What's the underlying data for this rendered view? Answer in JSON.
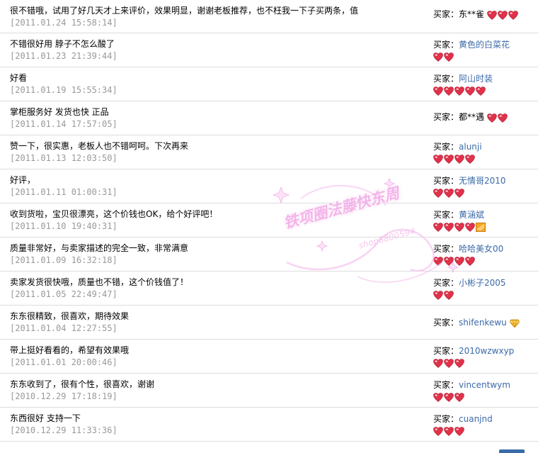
{
  "buyer_prefix": "买家：",
  "reviews": [
    {
      "comment": "很不错哦，试用了好几天才上来评价，效果明显，谢谢老板推荐，也不枉我一下子买两条，值",
      "date": "[2011.01.24 15:58:14]",
      "buyer": "东**雀",
      "hearts": 3
    },
    {
      "comment": "不错很好用 脖子不怎么酸了",
      "date": "[2011.01.23 21:39:44]",
      "buyer": "黄色的白菜花",
      "hearts": 2
    },
    {
      "comment": "好看",
      "date": "[2011.01.19 15:55:34]",
      "buyer": "阿山时装",
      "hearts": 5
    },
    {
      "comment": "掌柜服务好 发货也快 正品",
      "date": "[2011.01.14 17:57:05]",
      "buyer": "都**遇",
      "hearts": 2
    },
    {
      "comment": "赞一下，很实惠，老板人也不错呵呵。下次再来",
      "date": "[2011.01.13 12:03:50]",
      "buyer": "alunji",
      "hearts": 4
    },
    {
      "comment": "好评，",
      "date": "[2011.01.11 01:00:31]",
      "buyer": "无情哥2010",
      "hearts": 3
    },
    {
      "comment": "收到货啦，宝贝很漂亮，这个价钱也OK，给个好评吧！",
      "date": "[2011.01.10 19:40:31]",
      "buyer": "黄涵斌",
      "hearts": 4
    },
    {
      "comment": "质量非常好，与卖家描述的完全一致，非常满意",
      "date": "[2011.01.09 16:32:18]",
      "buyer": "哈哈美女00",
      "hearts": 4
    },
    {
      "comment": "卖家发货很快哦，质量也不错，这个价钱值了！",
      "date": "[2011.01.05 22:49:47]",
      "buyer": "小彬子2005",
      "hearts": 2
    },
    {
      "comment": "东东很精致，很喜欢，期待效果",
      "date": "[2011.01.04 12:27:55]",
      "buyer": "shifenkewu",
      "hearts": 0
    },
    {
      "comment": "带上挺好看看的，希望有效果哦",
      "date": "[2011.01.01 20:00:46]",
      "buyer": "2010wzwxyp",
      "hearts": 3
    },
    {
      "comment": "东东收到了，很有个性，很喜欢，谢谢",
      "date": "[2010.12.29 17:18:19]",
      "buyer": "vincentwym",
      "hearts": 3
    },
    {
      "comment": "东西很好 支持一下",
      "date": "[2010.12.29 11:33:36]",
      "buyer": "cuanjnd",
      "hearts": 3
    }
  ],
  "watermark": {
    "text": "铁项圈法藤快东周",
    "sub": "shop6800594"
  },
  "colors": {
    "link": "#3b6aa8",
    "date": "#999999",
    "heart": "#e0324a",
    "watermark": "#f2a8e6"
  }
}
